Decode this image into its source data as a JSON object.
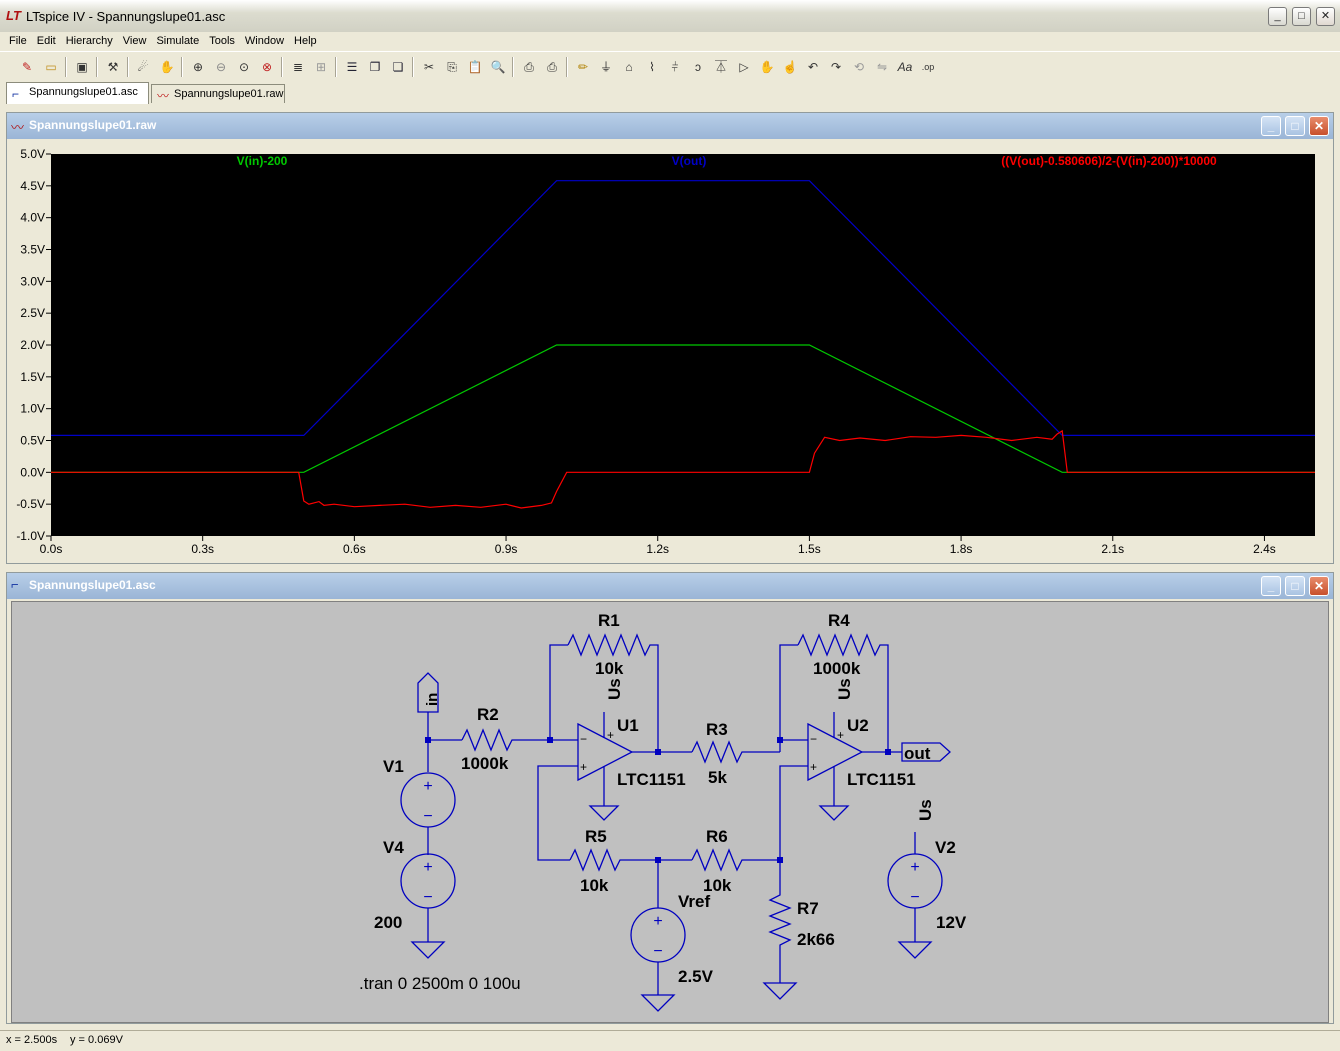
{
  "app": {
    "title": "LTspice IV - Spannungslupe01.asc",
    "logo": "LT"
  },
  "menu": [
    "File",
    "Edit",
    "Hierarchy",
    "View",
    "Simulate",
    "Tools",
    "Window",
    "Help"
  ],
  "toolbar_icons": [
    "new-schematic-icon",
    "open-icon",
    "save-icon",
    "control-panel-icon",
    "run-icon",
    "halt-icon",
    "zoom-in-icon",
    "zoom-out-icon",
    "zoom-area-icon",
    "zoom-cancel-icon",
    "autorange-icon",
    "grid-icon",
    "tile-horizontal-icon",
    "cascade-icon",
    "tile-vertical-icon",
    "cut-icon",
    "copy-icon",
    "paste-icon",
    "find-icon",
    "print-setup-icon",
    "print-icon",
    "draw-wire-icon",
    "ground-icon",
    "label-icon",
    "resistor-icon",
    "capacitor-icon",
    "inductor-icon",
    "diode-icon",
    "component-icon",
    "move-icon",
    "drag-icon",
    "undo-icon",
    "redo-icon",
    "rotate-icon",
    "mirror-icon",
    "text-icon",
    "spice-directive-icon"
  ],
  "tabs": [
    {
      "label": "Spannungslupe01.asc",
      "active": true
    },
    {
      "label": "Spannungslupe01.raw",
      "active": false
    }
  ],
  "waveform_window": {
    "title": "Spannungslupe01.raw"
  },
  "schematic_window": {
    "title": "Spannungslupe01.asc"
  },
  "chart_data": {
    "type": "line",
    "title": "",
    "xlabel": "",
    "ylabel": "",
    "xlim": [
      0,
      2.5
    ],
    "ylim": [
      -1.0,
      5.0
    ],
    "x_ticks": [
      "0.0s",
      "0.3s",
      "0.6s",
      "0.9s",
      "1.2s",
      "1.5s",
      "1.8s",
      "2.1s",
      "2.4s"
    ],
    "x_tick_values": [
      0,
      0.3,
      0.6,
      0.9,
      1.2,
      1.5,
      1.8,
      2.1,
      2.4
    ],
    "y_ticks": [
      "5.0V",
      "4.5V",
      "4.0V",
      "3.5V",
      "3.0V",
      "2.5V",
      "2.0V",
      "1.5V",
      "1.0V",
      "0.5V",
      "0.0V",
      "-0.5V",
      "-1.0V"
    ],
    "y_tick_values": [
      5.0,
      4.5,
      4.0,
      3.5,
      3.0,
      2.5,
      2.0,
      1.5,
      1.0,
      0.5,
      0.0,
      -0.5,
      -1.0
    ],
    "background": "#000000",
    "series": [
      {
        "name": "V(in)-200",
        "color": "#00c800",
        "x": [
          0,
          0.5,
          1.0,
          1.5,
          2.0,
          2.5
        ],
        "y": [
          0.0,
          0.0,
          2.0,
          2.0,
          0.0,
          0.0
        ]
      },
      {
        "name": "V(out)",
        "color": "#0000c8",
        "x": [
          0,
          0.5,
          1.0,
          1.5,
          2.0,
          2.5
        ],
        "y": [
          0.58,
          0.58,
          4.58,
          4.58,
          0.58,
          0.58
        ]
      },
      {
        "name": "((V(out)-0.580606)/2-(V(in)-200))*10000",
        "color": "#ff0000",
        "x": [
          0,
          0.49,
          0.5,
          0.51,
          0.53,
          0.54,
          0.56,
          0.6,
          0.65,
          0.7,
          0.75,
          0.8,
          0.85,
          0.9,
          0.93,
          0.97,
          0.99,
          1.0,
          1.02,
          1.5,
          1.51,
          1.53,
          1.56,
          1.6,
          1.65,
          1.7,
          1.75,
          1.8,
          1.85,
          1.9,
          1.95,
          1.98,
          1.99,
          2.0,
          2.01,
          2.5
        ],
        "y": [
          0.0,
          0.0,
          -0.45,
          -0.5,
          -0.46,
          -0.52,
          -0.5,
          -0.54,
          -0.52,
          -0.5,
          -0.55,
          -0.52,
          -0.55,
          -0.5,
          -0.56,
          -0.52,
          -0.48,
          -0.3,
          0.0,
          0.0,
          0.3,
          0.55,
          0.5,
          0.54,
          0.5,
          0.56,
          0.55,
          0.58,
          0.55,
          0.5,
          0.55,
          0.52,
          0.6,
          0.65,
          0.0,
          0.0
        ]
      }
    ]
  },
  "schematic": {
    "components": {
      "R1": {
        "name": "R1",
        "value": "10k"
      },
      "R2": {
        "name": "R2",
        "value": "1000k"
      },
      "R3": {
        "name": "R3",
        "value": "5k"
      },
      "R4": {
        "name": "R4",
        "value": "1000k"
      },
      "R5": {
        "name": "R5",
        "value": "10k"
      },
      "R6": {
        "name": "R6",
        "value": "10k"
      },
      "R7": {
        "name": "R7",
        "value": "2k66"
      },
      "U1": {
        "name": "U1",
        "value": "LTC1151"
      },
      "U2": {
        "name": "U2",
        "value": "LTC1151"
      },
      "V1": {
        "name": "V1"
      },
      "V4": {
        "name": "V4",
        "value": "200"
      },
      "V2": {
        "name": "V2",
        "value": "12V"
      },
      "Vref": {
        "name": "Vref",
        "value": "2.5V"
      }
    },
    "labels": {
      "in": "in",
      "out": "out",
      "us": "Us",
      "plus": "+",
      "minus": "−"
    },
    "directive": ".tran 0 2500m 0 100u"
  },
  "status": {
    "x": "x = 2.500s",
    "y": "y = 0.069V"
  }
}
